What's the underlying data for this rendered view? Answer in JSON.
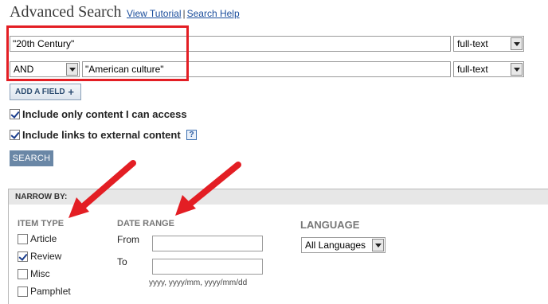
{
  "header": {
    "title": "Advanced Search",
    "view_tutorial": "View Tutorial",
    "separator": "|",
    "search_help": "Search Help"
  },
  "query": {
    "row1_value": "\"20th Century\"",
    "row1_field": "full-text",
    "row2_operator": "AND",
    "row2_value": "\"American culture\"",
    "row2_field": "full-text"
  },
  "add_field_label": "ADD A FIELD",
  "add_field_icon": "+",
  "options": {
    "only_access": "Include only content I can access",
    "only_access_checked": true,
    "external_links": "Include links to external content",
    "external_links_checked": true,
    "help_glyph": "?"
  },
  "search_button": "SEARCH",
  "narrow": {
    "heading": "NARROW BY:",
    "item_type": {
      "heading": "ITEM TYPE",
      "items": [
        {
          "label": "Article",
          "checked": false
        },
        {
          "label": "Review",
          "checked": true
        },
        {
          "label": "Misc",
          "checked": false
        },
        {
          "label": "Pamphlet",
          "checked": false
        }
      ]
    },
    "date_range": {
      "heading": "DATE RANGE",
      "from_label": "From",
      "to_label": "To",
      "from_value": "",
      "to_value": "",
      "hint": "yyyy, yyyy/mm, yyyy/mm/dd"
    },
    "language": {
      "heading": "LANGUAGE",
      "selected": "All Languages"
    }
  },
  "colors": {
    "highlight": "#e31e24",
    "link": "#1a4d9c",
    "search_button": "#6a87a6",
    "section_heading": "#777777"
  }
}
